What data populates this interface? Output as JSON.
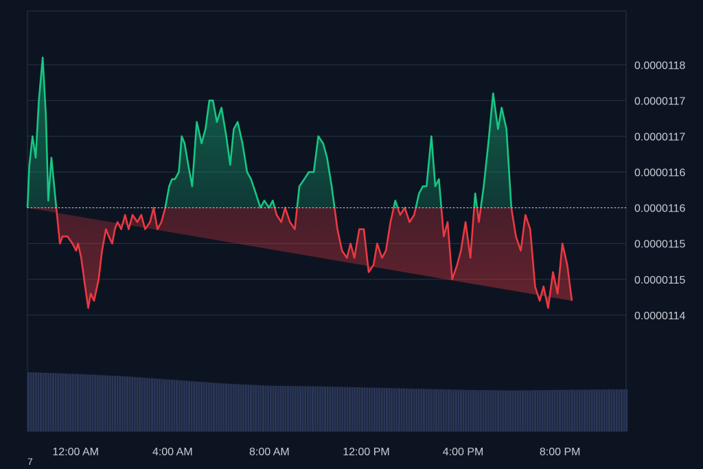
{
  "chart_data": {
    "type": "area",
    "title": "",
    "xlabel": "",
    "ylabel": "",
    "baseline": 1.16e-05,
    "ylim": [
      1.135e-05,
      1.183e-05
    ],
    "y_tick_labels": [
      "0.0000118",
      "0.0000117",
      "0.0000117",
      "0.0000116",
      "0.0000116",
      "0.0000115",
      "0.0000115",
      "0.0000114"
    ],
    "y_tick_values": [
      1.18e-05,
      1.175e-05,
      1.17e-05,
      1.165e-05,
      1.16e-05,
      1.155e-05,
      1.15e-05,
      1.145e-05
    ],
    "x_tick_labels": [
      "12:00 AM",
      "4:00 AM",
      "8:00 AM",
      "12:00 PM",
      "4:00 PM",
      "8:00 PM"
    ],
    "x_tick_hours": [
      1,
      5,
      9,
      13,
      17,
      21
    ],
    "x_range_hours": [
      -0.99,
      23.73
    ],
    "grid": true,
    "up_color": "#16c784",
    "down_color": "#ea3943",
    "series": [
      {
        "hours": [
          -0.99,
          -0.91,
          -0.78,
          -0.65,
          -0.52,
          -0.36,
          -0.23,
          -0.13,
          0.0,
          0.2,
          0.35,
          0.46,
          0.66,
          0.87,
          1.02,
          1.1,
          1.23,
          1.39,
          1.52,
          1.62,
          1.76,
          1.95,
          2.09,
          2.25,
          2.37,
          2.51,
          2.62,
          2.73,
          2.88,
          3.04,
          3.19,
          3.35,
          3.55,
          3.71,
          3.87,
          4.07,
          4.22,
          4.38,
          4.54,
          4.7,
          4.86,
          4.98,
          5.1,
          5.26,
          5.38,
          5.5,
          5.65,
          5.81,
          6.0,
          6.2,
          6.36,
          6.52,
          6.67,
          6.83,
          7.02,
          7.22,
          7.38,
          7.53,
          7.69,
          7.89,
          8.08,
          8.24,
          8.44,
          8.63,
          8.79,
          8.99,
          9.14,
          9.3,
          9.49,
          9.65,
          9.85,
          10.05,
          10.24,
          10.44,
          10.63,
          10.83,
          11.02,
          11.22,
          11.38,
          11.57,
          11.81,
          12.0,
          12.2,
          12.35,
          12.51,
          12.71,
          12.9,
          13.1,
          13.3,
          13.45,
          13.65,
          13.81,
          14.0,
          14.2,
          14.4,
          14.59,
          14.79,
          14.98,
          15.18,
          15.34,
          15.49,
          15.69,
          15.85,
          16.0,
          16.2,
          16.36,
          16.55,
          16.75,
          16.91,
          17.1,
          17.3,
          17.5,
          17.65,
          17.85,
          18.04,
          18.24,
          18.44,
          18.59,
          18.79,
          18.99,
          19.18,
          19.38,
          19.57,
          19.77,
          19.97,
          20.16,
          20.32,
          20.51,
          20.71,
          20.9,
          21.1,
          21.3,
          21.49,
          21.65,
          21.81,
          22.04,
          22.24,
          22.44,
          22.63,
          22.83,
          23.02,
          23.22,
          23.38,
          23.53,
          23.73
        ],
        "values": [
          1.16e-05,
          1.166e-05,
          1.17e-05,
          1.167e-05,
          1.175e-05,
          1.181e-05,
          1.173e-05,
          1.161e-05,
          1.167e-05,
          1.16e-05,
          1.155e-05,
          1.156e-05,
          1.156e-05,
          1.155e-05,
          1.154e-05,
          1.155e-05,
          1.153e-05,
          1.149e-05,
          1.146e-05,
          1.148e-05,
          1.147e-05,
          1.15e-05,
          1.154e-05,
          1.157e-05,
          1.156e-05,
          1.155e-05,
          1.157e-05,
          1.158e-05,
          1.157e-05,
          1.159e-05,
          1.157e-05,
          1.159e-05,
          1.158e-05,
          1.159e-05,
          1.157e-05,
          1.158e-05,
          1.16e-05,
          1.157e-05,
          1.158e-05,
          1.16e-05,
          1.163e-05,
          1.164e-05,
          1.164e-05,
          1.165e-05,
          1.17e-05,
          1.169e-05,
          1.166e-05,
          1.163e-05,
          1.172e-05,
          1.169e-05,
          1.171e-05,
          1.175e-05,
          1.175e-05,
          1.172e-05,
          1.174e-05,
          1.17e-05,
          1.166e-05,
          1.171e-05,
          1.172e-05,
          1.169e-05,
          1.165e-05,
          1.164e-05,
          1.162e-05,
          1.16e-05,
          1.161e-05,
          1.16e-05,
          1.161e-05,
          1.159e-05,
          1.158e-05,
          1.16e-05,
          1.158e-05,
          1.157e-05,
          1.163e-05,
          1.164e-05,
          1.165e-05,
          1.165e-05,
          1.17e-05,
          1.169e-05,
          1.167e-05,
          1.163e-05,
          1.157e-05,
          1.154e-05,
          1.153e-05,
          1.155e-05,
          1.153e-05,
          1.157e-05,
          1.157e-05,
          1.151e-05,
          1.152e-05,
          1.155e-05,
          1.153e-05,
          1.154e-05,
          1.158e-05,
          1.161e-05,
          1.159e-05,
          1.16e-05,
          1.158e-05,
          1.159e-05,
          1.162e-05,
          1.163e-05,
          1.163e-05,
          1.17e-05,
          1.163e-05,
          1.164e-05,
          1.156e-05,
          1.158e-05,
          1.15e-05,
          1.152e-05,
          1.154e-05,
          1.158e-05,
          1.153e-05,
          1.162e-05,
          1.158e-05,
          1.163e-05,
          1.169e-05,
          1.176e-05,
          1.171e-05,
          1.174e-05,
          1.171e-05,
          1.16e-05,
          1.156e-05,
          1.154e-05,
          1.159e-05,
          1.157e-05,
          1.149e-05,
          1.147e-05,
          1.149e-05,
          1.146e-05,
          1.151e-05,
          1.148e-05,
          1.155e-05,
          1.152e-05,
          1.147e-05
        ]
      }
    ],
    "volume": {
      "hours": [
        -0.99,
        1.0,
        3.0,
        5.0,
        7.0,
        9.0,
        11.0,
        13.0,
        15.0,
        17.0,
        19.0,
        21.0,
        23.5,
        23.73
      ],
      "values": [
        1.0,
        0.97,
        0.93,
        0.87,
        0.81,
        0.77,
        0.76,
        0.74,
        0.72,
        0.7,
        0.69,
        0.7,
        0.71,
        0.71
      ]
    }
  },
  "corner_mark": "7"
}
